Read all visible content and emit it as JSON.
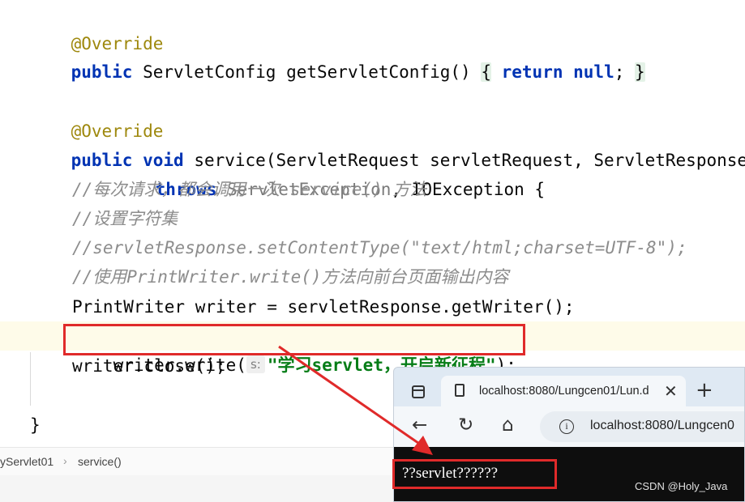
{
  "editor": {
    "lines": {
      "l1_annot": "@Override",
      "l2_public": "public",
      "l2_sig": " ServletConfig getServletConfig() ",
      "l2_open": "{",
      "l2_return": "return",
      "l2_null": "null",
      "l2_semi": "; ",
      "l2_close": "}",
      "l3_annot": "@Override",
      "l4_public": "public",
      "l4_void": "void",
      "l4_sig": " service(ServletRequest servletRequest, ServletResponse s",
      "l5_throws": "throws",
      "l5_exc": "ServletException",
      "l5_rest": ", IOException {",
      "c1": "//每次请求，都会调用一次 service() 方法",
      "c2": "//设置字符集",
      "c3": "//servletResponse.setContentType(\"text/html;charset=UTF-8\");",
      "c4": "//使用PrintWriter.write()方法向前台页面输出内容",
      "l6": "PrintWriter writer = servletResponse.getWriter();",
      "l7_pre": "writer.write(",
      "l7_hint": "s:",
      "l7_str": "\"学习servlet，开启新征程\"",
      "l7_post": ");",
      "l8": "writer.close();",
      "l9": "}"
    }
  },
  "breadcrumb": {
    "class_item": "yServlet01",
    "method_item": "service()"
  },
  "browser": {
    "tab_title": "localhost:8080/Lungcen01/Lun.d",
    "url": "localhost:8080/Lungcen0",
    "page_output": "??servlet??????"
  },
  "watermark": "CSDN @Holy_Java",
  "colors": {
    "keyword": "#0033b3",
    "annotation": "#9e880d",
    "comment": "#8c8c8c",
    "string": "#067d17",
    "highlight_box": "#e02a2a"
  }
}
